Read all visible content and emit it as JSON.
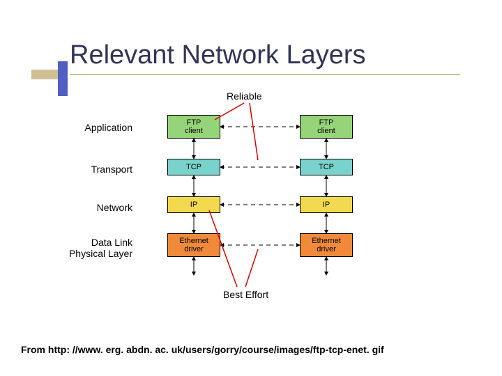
{
  "title": "Relevant Network Layers",
  "top_label": "Reliable",
  "bottom_label": "Best Effort",
  "layers": {
    "application": "Application",
    "transport": "Transport",
    "network": "Network",
    "datalink": "Data Link\nPhysical Layer"
  },
  "boxes": {
    "ftp_client": "FTP\nclient",
    "tcp": "TCP",
    "ip": "IP",
    "ethernet": "Ethernet\ndriver"
  },
  "caption": "From http: //www. erg. abdn. ac. uk/users/gorry/course/images/ftp-tcp-enet. gif"
}
